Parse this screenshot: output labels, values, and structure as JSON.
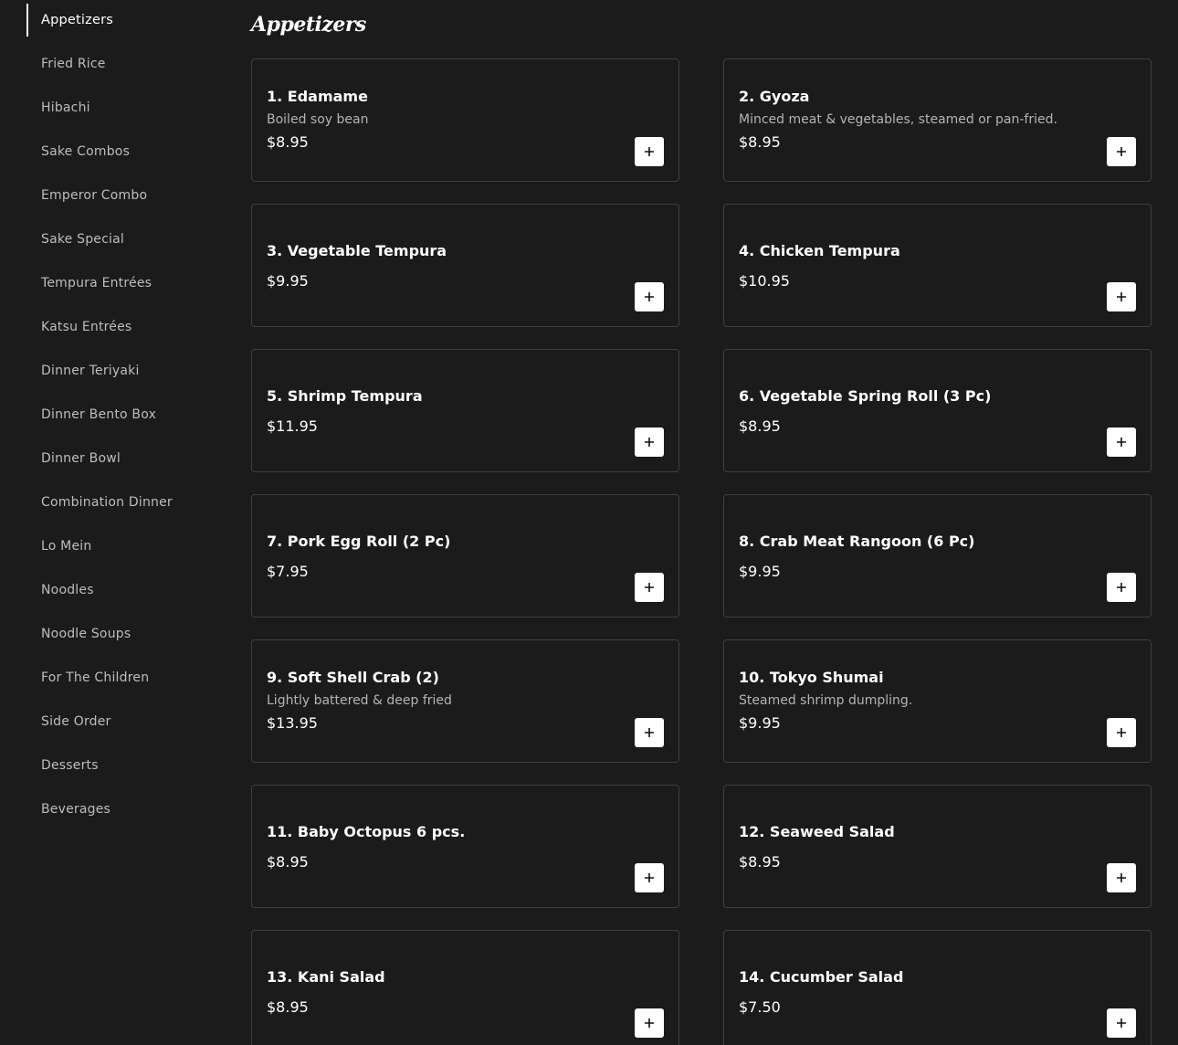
{
  "sidebar": {
    "items": [
      {
        "label": "Appetizers",
        "active": true
      },
      {
        "label": "Fried Rice"
      },
      {
        "label": "Hibachi"
      },
      {
        "label": "Sake Combos"
      },
      {
        "label": "Emperor Combo"
      },
      {
        "label": "Sake Special"
      },
      {
        "label": "Tempura Entrées"
      },
      {
        "label": "Katsu Entrées"
      },
      {
        "label": "Dinner Teriyaki"
      },
      {
        "label": "Dinner Bento Box"
      },
      {
        "label": "Dinner Bowl"
      },
      {
        "label": "Combination Dinner"
      },
      {
        "label": "Lo Mein"
      },
      {
        "label": "Noodles"
      },
      {
        "label": "Noodle Soups"
      },
      {
        "label": "For The Children"
      },
      {
        "label": "Side Order"
      },
      {
        "label": "Desserts"
      },
      {
        "label": "Beverages"
      }
    ]
  },
  "section": {
    "title": "Appetizers"
  },
  "items": [
    {
      "name": "1. Edamame",
      "desc": "Boiled soy bean",
      "price": "$8.95"
    },
    {
      "name": "2. Gyoza",
      "desc": "Minced meat & vegetables, steamed or pan-fried.",
      "price": "$8.95"
    },
    {
      "name": "3. Vegetable Tempura",
      "desc": "",
      "price": "$9.95"
    },
    {
      "name": "4. Chicken Tempura",
      "desc": "",
      "price": "$10.95"
    },
    {
      "name": "5. Shrimp Tempura",
      "desc": "",
      "price": "$11.95"
    },
    {
      "name": "6. Vegetable Spring Roll (3 Pc)",
      "desc": "",
      "price": "$8.95"
    },
    {
      "name": "7. Pork Egg Roll (2 Pc)",
      "desc": "",
      "price": "$7.95"
    },
    {
      "name": "8. Crab Meat Rangoon (6 Pc)",
      "desc": "",
      "price": "$9.95"
    },
    {
      "name": "9. Soft Shell Crab (2)",
      "desc": "Lightly battered & deep fried",
      "price": "$13.95"
    },
    {
      "name": "10. Tokyo Shumai",
      "desc": "Steamed shrimp dumpling.",
      "price": "$9.95"
    },
    {
      "name": "11. Baby Octopus 6 pcs.",
      "desc": "",
      "price": "$8.95"
    },
    {
      "name": "12. Seaweed Salad",
      "desc": "",
      "price": "$8.95"
    },
    {
      "name": "13. Kani Salad",
      "desc": "",
      "price": "$8.95"
    },
    {
      "name": "14. Cucumber Salad",
      "desc": "",
      "price": "$7.50"
    }
  ],
  "icons": {
    "add": "plus-icon"
  },
  "colors": {
    "background": "#1b1b1b",
    "card_border": "#3e3e3e",
    "text": "#ffffff",
    "muted_text": "#bdbdbd",
    "button_bg": "#ffffff"
  }
}
